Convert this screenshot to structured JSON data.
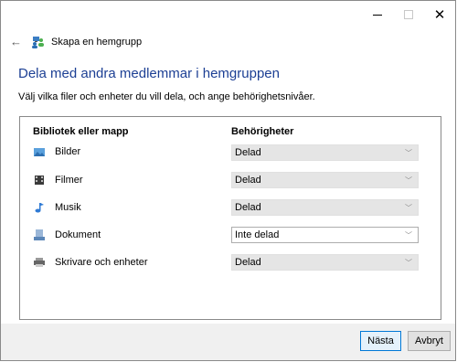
{
  "nav": {
    "title": "Skapa en hemgrupp"
  },
  "header": {
    "heading": "Dela med andra medlemmar i hemgruppen",
    "instruction": "Välj vilka filer och enheter du vill dela, och ange behörighetsnivåer."
  },
  "table": {
    "col_library": "Bibliotek eller mapp",
    "col_permissions": "Behörigheter",
    "rows": [
      {
        "label": "Bilder",
        "value": "Delad"
      },
      {
        "label": "Filmer",
        "value": "Delad"
      },
      {
        "label": "Musik",
        "value": "Delad"
      },
      {
        "label": "Dokument",
        "value": "Inte delad"
      },
      {
        "label": "Skrivare och enheter",
        "value": "Delad"
      }
    ]
  },
  "buttons": {
    "next": "Nästa",
    "cancel": "Avbryt"
  },
  "icons": {
    "back": "back-arrow-icon",
    "homegroup": "homegroup-icon",
    "pictures": "pictures-icon",
    "videos": "videos-icon",
    "music": "music-icon",
    "documents": "documents-icon",
    "printers": "printers-icon"
  },
  "colors": {
    "heading": "#1c3f94",
    "primary_border": "#0078d7"
  }
}
